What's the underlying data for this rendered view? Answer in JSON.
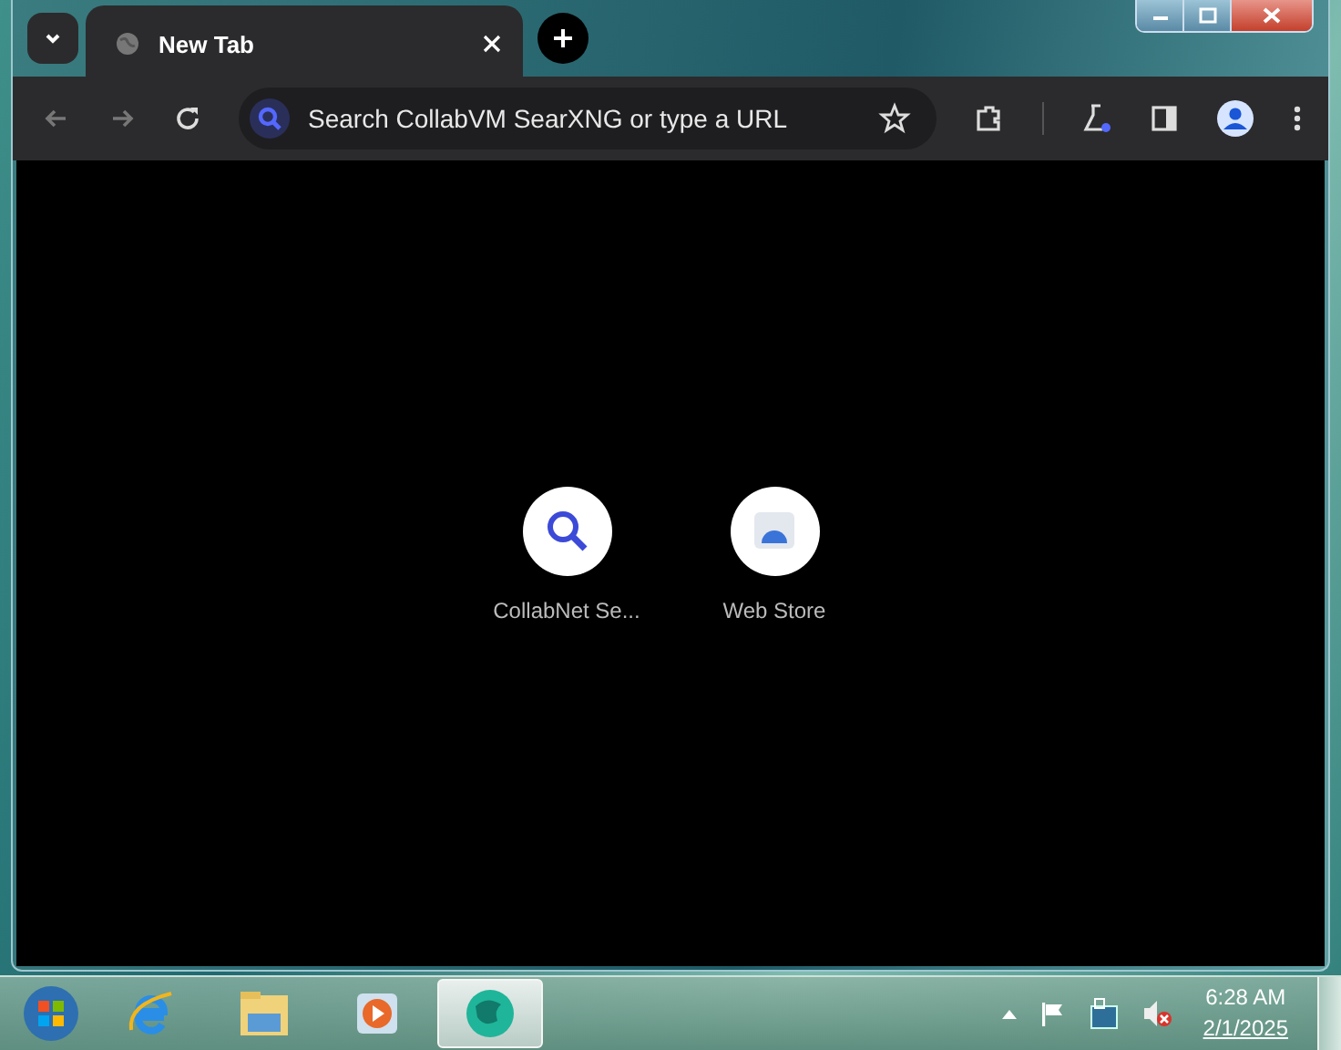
{
  "tab": {
    "title": "New Tab"
  },
  "omnibox": {
    "placeholder": "Search CollabVM SearXNG or type a URL"
  },
  "shortcuts": [
    {
      "label": "CollabNet Se...",
      "kind": "search"
    },
    {
      "label": "Web Store",
      "kind": "store"
    }
  ],
  "taskbar": {
    "apps": [
      {
        "kind": "ie",
        "selected": false
      },
      {
        "kind": "explorer",
        "selected": false
      },
      {
        "kind": "media",
        "selected": false
      },
      {
        "kind": "browser",
        "selected": true
      }
    ],
    "clock": {
      "time": "6:28 AM",
      "date": "2/1/2025"
    }
  }
}
